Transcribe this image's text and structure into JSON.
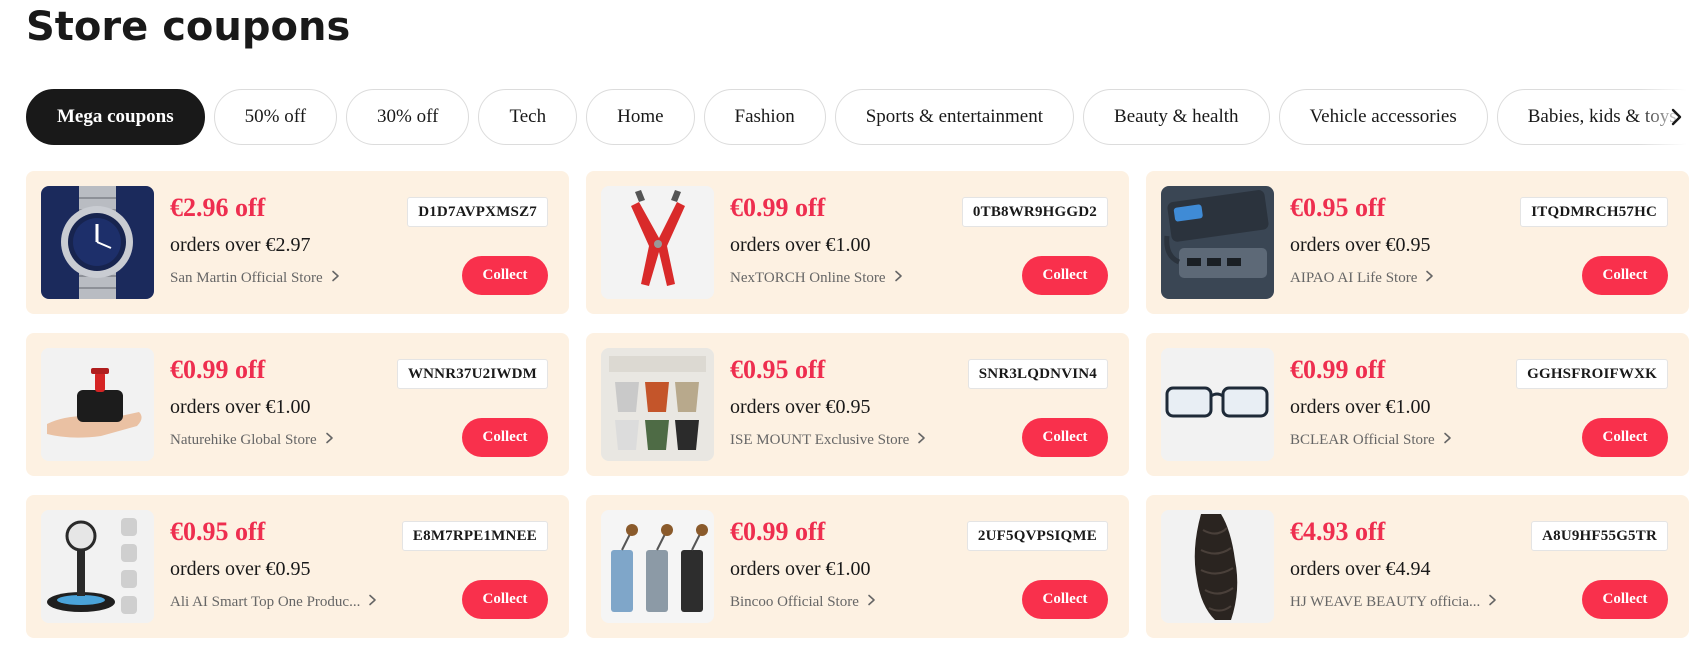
{
  "page": {
    "title": "Store coupons"
  },
  "categories": [
    {
      "label": "Mega coupons",
      "active": true
    },
    {
      "label": "50% off"
    },
    {
      "label": "30% off"
    },
    {
      "label": "Tech"
    },
    {
      "label": "Home"
    },
    {
      "label": "Fashion"
    },
    {
      "label": "Sports & entertainment"
    },
    {
      "label": "Beauty & health"
    },
    {
      "label": "Vehicle accessories"
    },
    {
      "label": "Babies, kids & toys"
    }
  ],
  "colors": {
    "accent": "#ee2e4f",
    "button": "#f9304c",
    "card_bg": "#fdf1e2",
    "active_chip": "#191919"
  },
  "coupons": [
    {
      "discount": "€2.96 off",
      "condition": "orders over €2.97",
      "store": "San Martin Official Store",
      "code": "D1D7AVPXMSZ7",
      "button": "Collect",
      "image": "wristwatch"
    },
    {
      "discount": "€0.99 off",
      "condition": "orders over €1.00",
      "store": "NexTORCH Online Store",
      "code": "0TB8WR9HGGD2",
      "button": "Collect",
      "image": "multitool"
    },
    {
      "discount": "€0.95 off",
      "condition": "orders over €0.95",
      "store": "AIPAO AI Life Store",
      "code": "ITQDMRCH57HC",
      "button": "Collect",
      "image": "usb-hub"
    },
    {
      "discount": "€0.99 off",
      "condition": "orders over €1.00",
      "store": "Naturehike Global Store",
      "code": "WNNR37U2IWDM",
      "button": "Collect",
      "image": "pump-in-hand"
    },
    {
      "discount": "€0.95 off",
      "condition": "orders over €0.95",
      "store": "ISE MOUNT Exclusive Store",
      "code": "SNR3LQDNVIN4",
      "button": "Collect",
      "image": "camping-cups"
    },
    {
      "discount": "€0.99 off",
      "condition": "orders over €1.00",
      "store": "BCLEAR Official Store",
      "code": "GGHSFROIFWXK",
      "button": "Collect",
      "image": "glasses"
    },
    {
      "discount": "€0.95 off",
      "condition": "orders over €0.95",
      "store": "Ali AI Smart Top One Produc...",
      "code": "E8M7RPE1MNEE",
      "button": "Collect",
      "image": "charger-stand"
    },
    {
      "discount": "€0.99 off",
      "condition": "orders over €1.00",
      "store": "Bincoo Official Store",
      "code": "2UF5QVPSIQME",
      "button": "Collect",
      "image": "coffee-grinders"
    },
    {
      "discount": "€4.93 off",
      "condition": "orders over €4.94",
      "store": "HJ WEAVE BEAUTY officia...",
      "code": "A8U9HF55G5TR",
      "button": "Collect",
      "image": "hair-bundle"
    }
  ]
}
